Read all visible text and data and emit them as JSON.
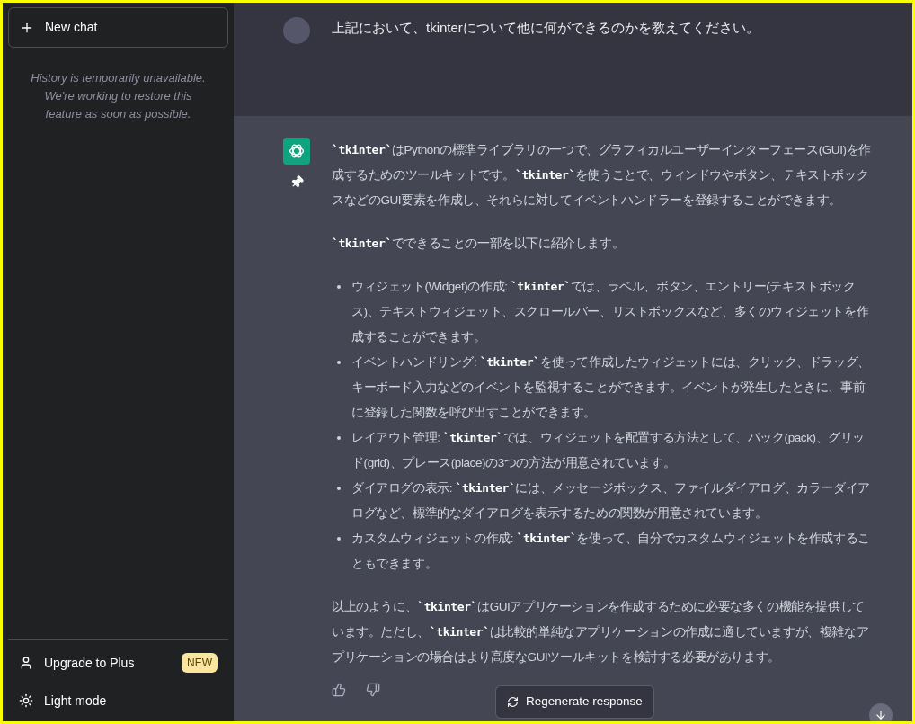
{
  "sidebar": {
    "new_chat": "New chat",
    "notice": "History is temporarily unavailable. We're working to restore this feature as soon as possible.",
    "footer_items": [
      {
        "kind": "upgrade",
        "label": "Upgrade to Plus",
        "badge": "NEW"
      },
      {
        "kind": "theme",
        "label": "Light mode"
      }
    ]
  },
  "messages": [
    {
      "kind": "user",
      "text": "上記において、tkinterについて他に何ができるのかを教えてください。"
    },
    {
      "kind": "assistant",
      "blocks": [
        {
          "kind": "paragraph",
          "segments": [
            {
              "kind": "code",
              "text": "`tkinter`"
            },
            {
              "kind": "text",
              "text": "はPythonの標準ライブラリの一つで、グラフィカルユーザーインターフェース(GUI)を作成するためのツールキットです。"
            },
            {
              "kind": "code",
              "text": "`tkinter`"
            },
            {
              "kind": "text",
              "text": "を使うことで、ウィンドウやボタン、テキストボックスなどのGUI要素を作成し、それらに対してイベントハンドラーを登録することができます。"
            }
          ]
        },
        {
          "kind": "paragraph",
          "segments": [
            {
              "kind": "code",
              "text": "`tkinter`"
            },
            {
              "kind": "text",
              "text": "でできることの一部を以下に紹介します。"
            }
          ]
        },
        {
          "kind": "list",
          "items": [
            [
              {
                "kind": "text",
                "text": "ウィジェット(Widget)の作成: "
              },
              {
                "kind": "code",
                "text": "`tkinter`"
              },
              {
                "kind": "text",
                "text": "では、ラベル、ボタン、エントリー(テキストボックス)、テキストウィジェット、スクロールバー、リストボックスなど、多くのウィジェットを作成することができます。"
              }
            ],
            [
              {
                "kind": "text",
                "text": "イベントハンドリング: "
              },
              {
                "kind": "code",
                "text": "`tkinter`"
              },
              {
                "kind": "text",
                "text": "を使って作成したウィジェットには、クリック、ドラッグ、キーボード入力などのイベントを監視することができます。イベントが発生したときに、事前に登録した関数を呼び出すことができます。"
              }
            ],
            [
              {
                "kind": "text",
                "text": "レイアウト管理: "
              },
              {
                "kind": "code",
                "text": "`tkinter`"
              },
              {
                "kind": "text",
                "text": "では、ウィジェットを配置する方法として、パック(pack)、グリッド(grid)、プレース(place)の3つの方法が用意されています。"
              }
            ],
            [
              {
                "kind": "text",
                "text": "ダイアログの表示: "
              },
              {
                "kind": "code",
                "text": "`tkinter`"
              },
              {
                "kind": "text",
                "text": "には、メッセージボックス、ファイルダイアログ、カラーダイアログなど、標準的なダイアログを表示するための関数が用意されています。"
              }
            ],
            [
              {
                "kind": "text",
                "text": "カスタムウィジェットの作成: "
              },
              {
                "kind": "code",
                "text": "`tkinter`"
              },
              {
                "kind": "text",
                "text": "を使って、自分でカスタムウィジェットを作成することもできます。"
              }
            ]
          ]
        },
        {
          "kind": "paragraph",
          "segments": [
            {
              "kind": "text",
              "text": "以上のように、"
            },
            {
              "kind": "code",
              "text": "`tkinter`"
            },
            {
              "kind": "text",
              "text": "はGUIアプリケーションを作成するために必要な多くの機能を提供しています。ただし、"
            },
            {
              "kind": "code",
              "text": "`tkinter`"
            },
            {
              "kind": "text",
              "text": "は比較的単純なアプリケーションの作成に適していますが、複雑なアプリケーションの場合はより高度なGUIツールキットを検討する必要があります。"
            }
          ]
        }
      ]
    }
  ],
  "regenerate": "Regenerate response"
}
